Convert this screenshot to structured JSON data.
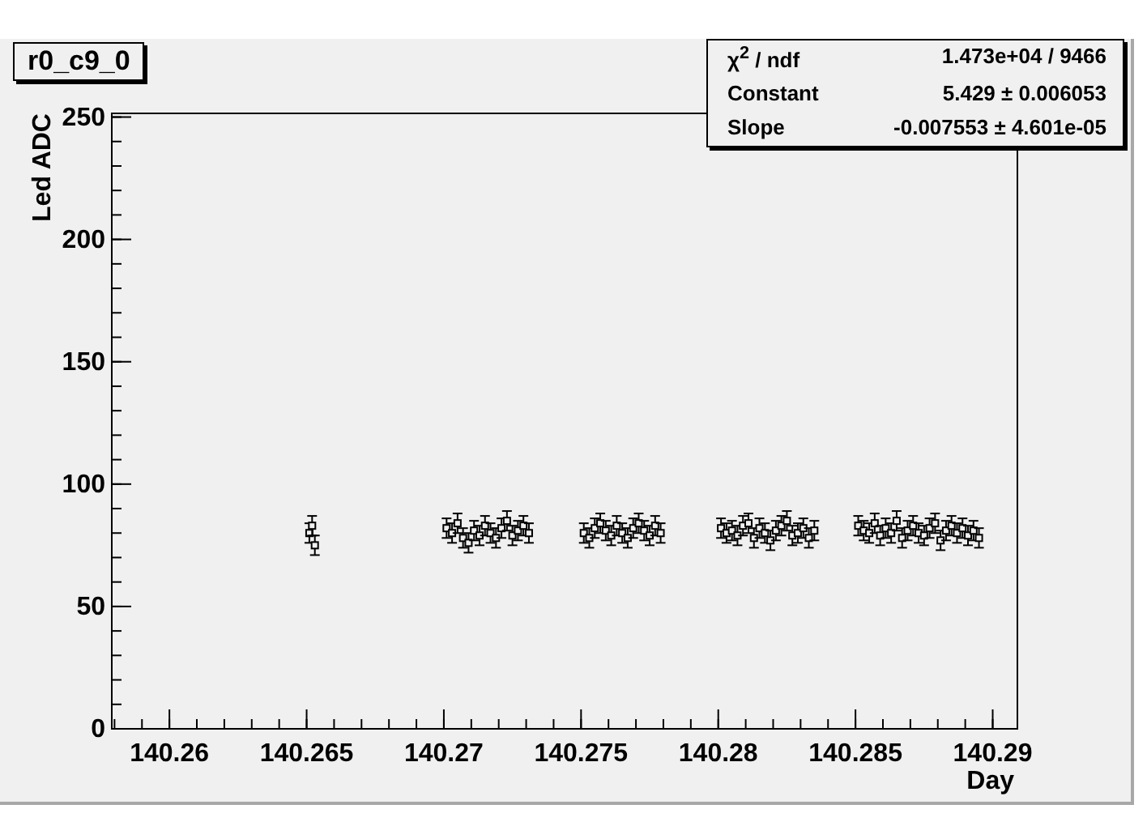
{
  "title_box": {
    "text": "r0_c9_0"
  },
  "stats_box": {
    "rows": [
      {
        "label": "χ$^{2}$ / ndf",
        "value": "1.473e+04 / 9466"
      },
      {
        "label": "Constant",
        "value": "5.429 ± 0.006053"
      },
      {
        "label": "Slope",
        "value": "-0.007553 ± 4.601e-05"
      }
    ]
  },
  "chart_data": {
    "type": "scatter",
    "xlabel": "Day",
    "ylabel": "Led ADC",
    "xlim": [
      140.2579,
      140.2909
    ],
    "ylim": [
      0,
      251.5
    ],
    "xticks": [
      {
        "value": 140.26,
        "label": "140.26"
      },
      {
        "value": 140.265,
        "label": "140.265"
      },
      {
        "value": 140.27,
        "label": "140.27"
      },
      {
        "value": 140.275,
        "label": "140.275"
      },
      {
        "value": 140.28,
        "label": "140.28"
      },
      {
        "value": 140.285,
        "label": "140.285"
      },
      {
        "value": 140.29,
        "label": "140.29"
      }
    ],
    "yticks": [
      0,
      50,
      100,
      150,
      200,
      250
    ],
    "x": [
      140.2651,
      140.2652,
      140.2653,
      140.2701,
      140.2703,
      140.2705,
      140.2707,
      140.2709,
      140.2711,
      140.2713,
      140.2715,
      140.2717,
      140.2719,
      140.2721,
      140.2723,
      140.2725,
      140.2727,
      140.2729,
      140.2731,
      140.2751,
      140.2753,
      140.2755,
      140.2757,
      140.2759,
      140.2761,
      140.2763,
      140.2765,
      140.2767,
      140.2769,
      140.2771,
      140.2773,
      140.2775,
      140.2777,
      140.2779,
      140.2801,
      140.2803,
      140.2805,
      140.2807,
      140.2809,
      140.2811,
      140.2813,
      140.2815,
      140.2817,
      140.2819,
      140.2821,
      140.2823,
      140.2825,
      140.2827,
      140.2829,
      140.2831,
      140.2833,
      140.2835,
      140.2851,
      140.2853,
      140.2855,
      140.2857,
      140.2859,
      140.2861,
      140.2863,
      140.2865,
      140.2867,
      140.2869,
      140.2871,
      140.2873,
      140.2875,
      140.2877,
      140.2879,
      140.2881,
      140.2883,
      140.2885,
      140.2887,
      140.2889,
      140.2891,
      140.2893,
      140.2895
    ],
    "series": [
      {
        "color": "#000000",
        "values": [
          80,
          83,
          75,
          82,
          80,
          84,
          78,
          76,
          81,
          79,
          83,
          80,
          78,
          82,
          85,
          79,
          81,
          83,
          80,
          80,
          78,
          82,
          84,
          81,
          79,
          83,
          80,
          78,
          82,
          84,
          81,
          79,
          83,
          80,
          82,
          80,
          81,
          79,
          83,
          84,
          78,
          82,
          80,
          77,
          81,
          83,
          85,
          79,
          80,
          82,
          78,
          81,
          83,
          81,
          80,
          84,
          79,
          82,
          80,
          85,
          78,
          81,
          83,
          80,
          79,
          82,
          84,
          77,
          81,
          83,
          80,
          82,
          79,
          81,
          78
        ]
      }
    ]
  }
}
